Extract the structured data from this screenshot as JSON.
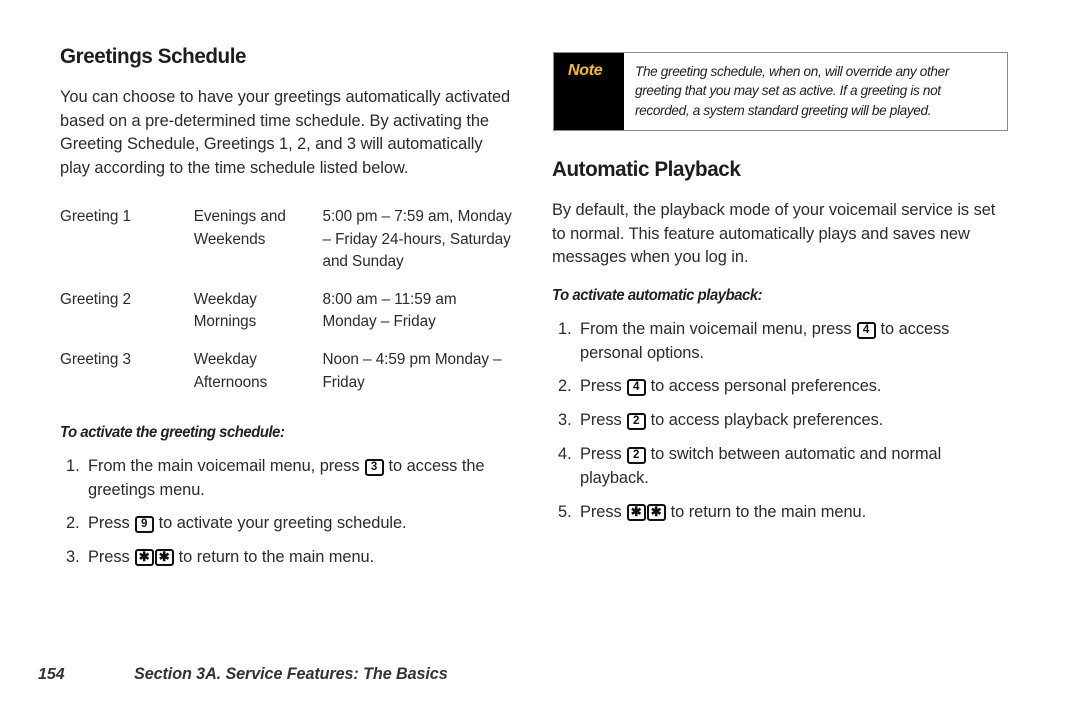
{
  "document": {
    "type": "user-manual-page",
    "page_number": "154",
    "section_footer": "Section 3A. Service Features: The Basics"
  },
  "left_column": {
    "heading": "Greetings Schedule",
    "intro": "You can choose to have your greetings automatically activated based on a pre-determined time schedule. By activating the Greeting Schedule, Greetings 1, 2, and 3 will automatically play according to the time schedule listed below.",
    "schedule_table": {
      "rows": [
        {
          "greeting": "Greeting 1",
          "period": "Evenings and Weekends",
          "times": "5:00 pm – 7:59 am, Monday – Friday 24-hours, Saturday and Sunday"
        },
        {
          "greeting": "Greeting 2",
          "period": "Weekday Mornings",
          "times": "8:00 am – 11:59 am Monday – Friday"
        },
        {
          "greeting": "Greeting 3",
          "period": "Weekday Afternoons",
          "times": "Noon – 4:59 pm Monday – Friday"
        }
      ]
    },
    "lead_in": "To activate the greeting schedule:",
    "steps": [
      {
        "before": "From the main voicemail menu, press",
        "keys": [
          "3"
        ],
        "after": "to access the greetings menu."
      },
      {
        "before": "Press",
        "keys": [
          "9"
        ],
        "after": "to activate your greeting schedule."
      },
      {
        "before": "Press",
        "keys": [
          "*",
          "*"
        ],
        "after": "to return to the main menu."
      }
    ]
  },
  "note": {
    "label": "Note",
    "text": "The greeting schedule, when on, will override any other greeting that you may set as active. If a greeting is not recorded, a system standard greeting will be played.",
    "label_color": "#f5c200",
    "background_color": "#000000"
  },
  "right_column": {
    "heading": "Automatic Playback",
    "intro": "By default, the playback mode of your voicemail service is set to normal. This feature automatically plays and saves new messages when you log in.",
    "lead_in": "To activate automatic playback:",
    "steps": [
      {
        "before": "From the main voicemail menu, press",
        "keys": [
          "4"
        ],
        "after": "to access personal options."
      },
      {
        "before": "Press",
        "keys": [
          "4"
        ],
        "after": "to access personal preferences."
      },
      {
        "before": "Press",
        "keys": [
          "2"
        ],
        "after": "to access playback preferences."
      },
      {
        "before": "Press",
        "keys": [
          "2"
        ],
        "after": "to switch between automatic and normal playback."
      },
      {
        "before": "Press",
        "keys": [
          "*",
          "*"
        ],
        "after": "to return to the main menu."
      }
    ]
  }
}
